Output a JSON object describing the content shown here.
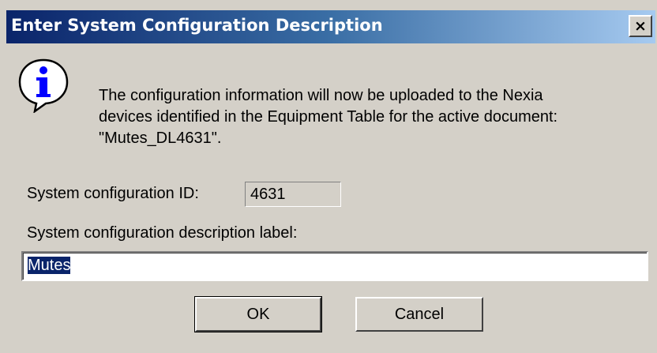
{
  "dialog": {
    "title": "Enter System Configuration Description",
    "close_glyph": "×",
    "icon": "info-icon",
    "message_lines": [
      "The configuration information will now be uploaded to the Nexia",
      "devices identified in the Equipment Table for the active document:",
      "\"Mutes_DL4631\"."
    ],
    "config_id_label": "System configuration ID:",
    "config_id_value": "4631",
    "description_label": "System configuration description label:",
    "description_value": "Mutes",
    "ok_label": "OK",
    "cancel_label": "Cancel"
  },
  "colors": {
    "dialog_face": "#d4d0c8",
    "title_start": "#0a246a",
    "title_end": "#a6caf0",
    "selection": "#0a246a"
  }
}
